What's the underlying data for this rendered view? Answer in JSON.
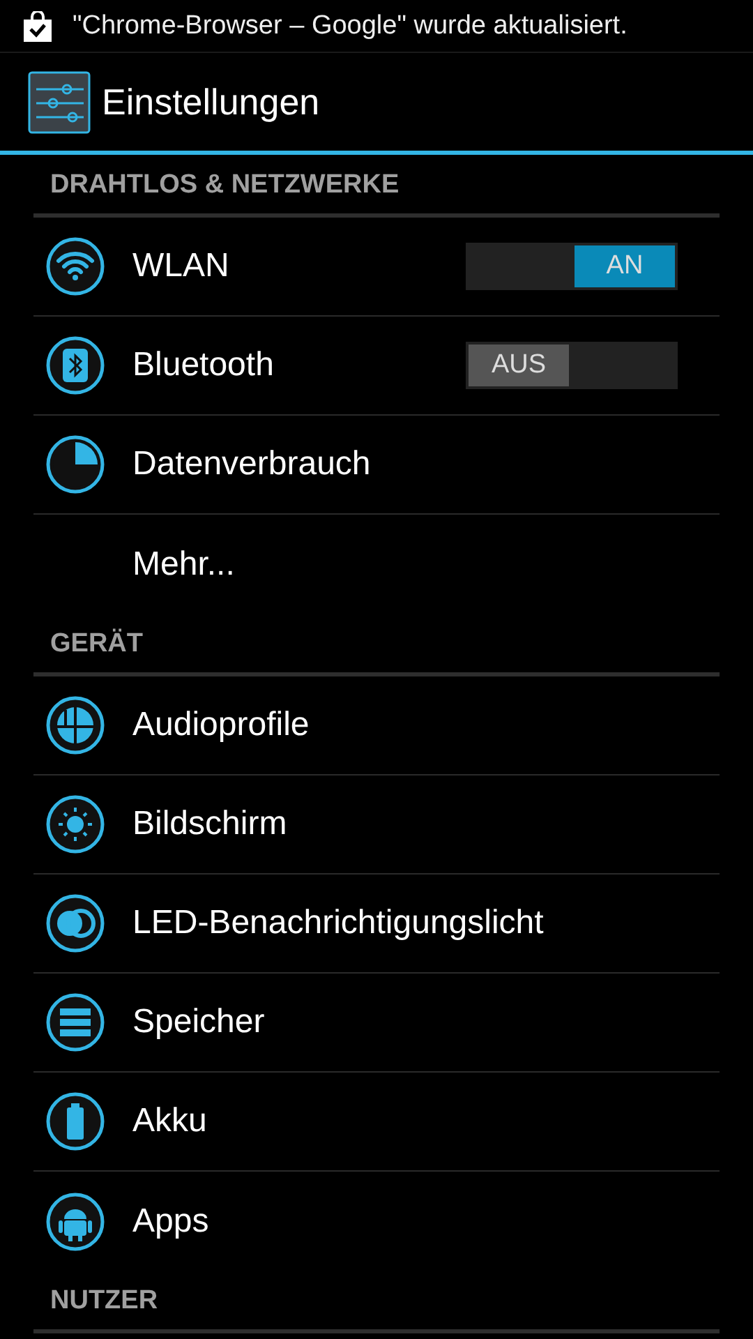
{
  "notification": {
    "text": "\"Chrome-Browser – Google\" wurde aktualisiert."
  },
  "action_bar": {
    "title": "Einstellungen"
  },
  "sections": [
    {
      "header": "DRAHTLOS & NETZWERKE",
      "items": [
        {
          "kind": "switch",
          "label": "WLAN",
          "switch": {
            "label": "AN",
            "on": true
          }
        },
        {
          "kind": "switch",
          "label": "Bluetooth",
          "switch": {
            "label": "AUS",
            "on": false
          }
        },
        {
          "kind": "icon",
          "label": "Datenverbrauch"
        },
        {
          "kind": "text",
          "label": "Mehr..."
        }
      ]
    },
    {
      "header": "GERÄT",
      "items": [
        {
          "kind": "icon",
          "label": "Audioprofile"
        },
        {
          "kind": "icon",
          "label": "Bildschirm"
        },
        {
          "kind": "icon",
          "label": "LED-Benachrichtigungslicht"
        },
        {
          "kind": "icon",
          "label": "Speicher"
        },
        {
          "kind": "icon",
          "label": "Akku"
        },
        {
          "kind": "icon",
          "label": "Apps"
        }
      ]
    },
    {
      "header": "NUTZER"
    }
  ]
}
